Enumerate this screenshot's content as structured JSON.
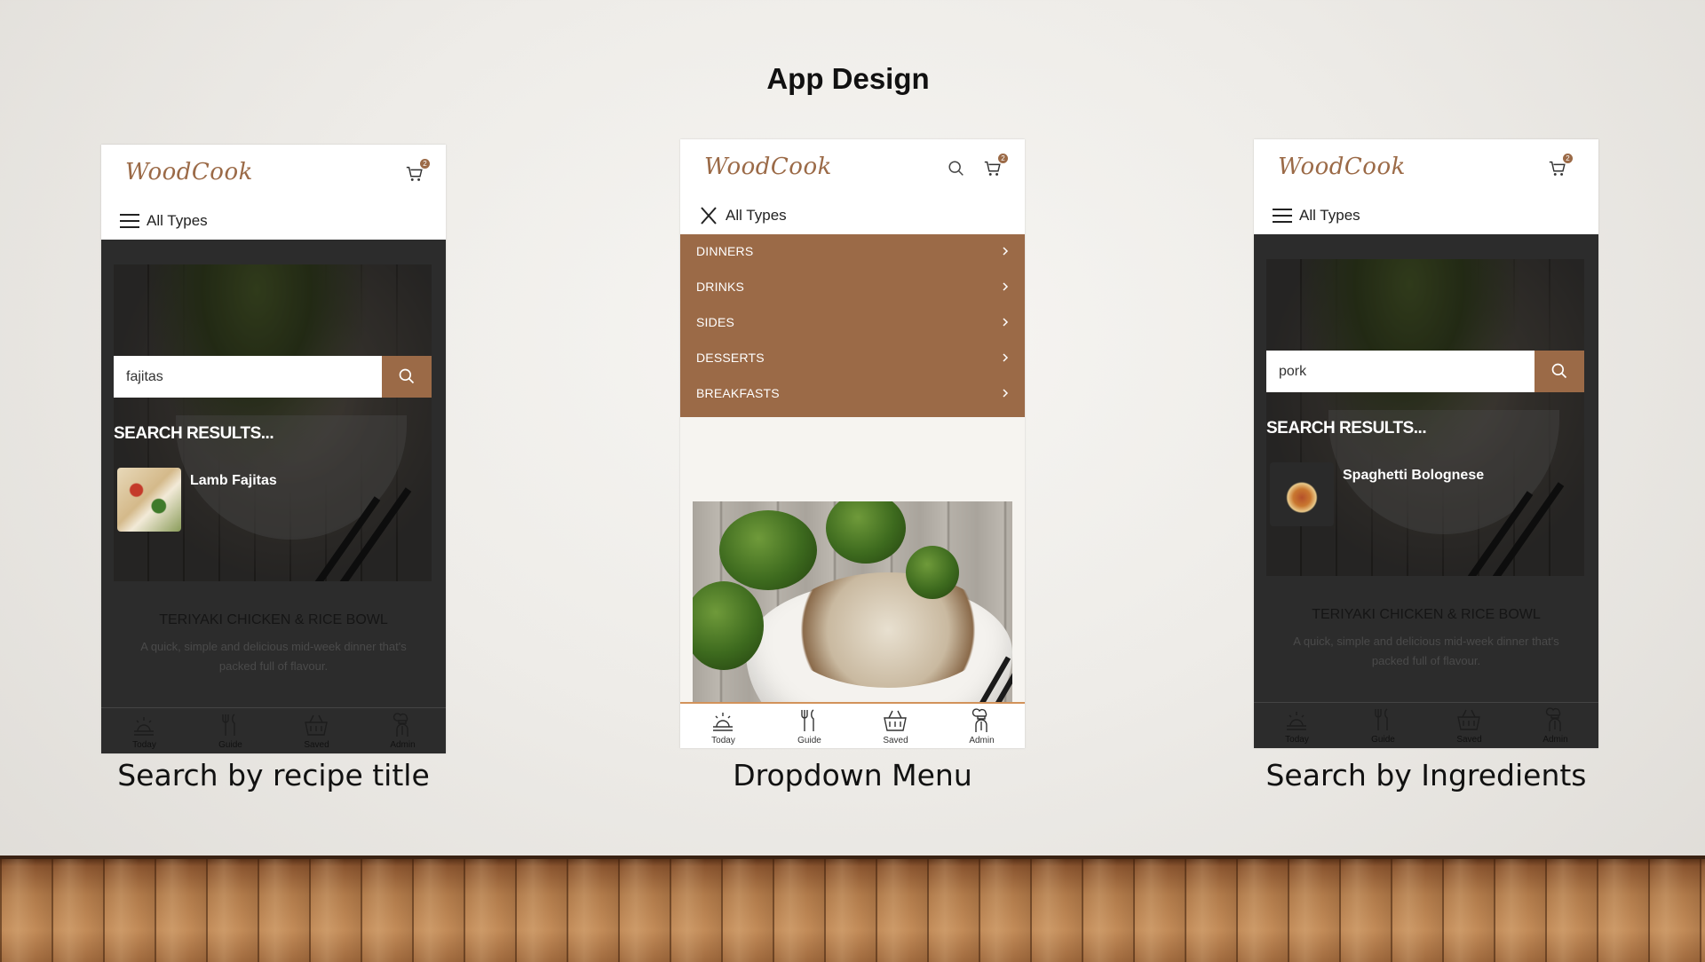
{
  "slide": {
    "title": "App Design"
  },
  "captions": [
    "Search by recipe title",
    "Dropdown Menu",
    "Search by Ingredients"
  ],
  "app": {
    "logo": "WoodCook",
    "cart_count": "2",
    "type_filter": "All Types",
    "search_results_heading": "SEARCH RESULTS...",
    "feature": {
      "title": "TERIYAKI CHICKEN & RICE BOWL",
      "description": "A quick, simple and delicious mid-week dinner that's packed full of flavour."
    },
    "nav": [
      "Today",
      "Guide",
      "Saved",
      "Admin"
    ],
    "accent_color": "#9b6a47"
  },
  "screen1": {
    "search_value": "fajitas",
    "result": "Lamb Fajitas"
  },
  "screen2": {
    "menu": [
      "DINNERS",
      "DRINKS",
      "SIDES",
      "DESSERTS",
      "BREAKFASTS"
    ]
  },
  "screen3": {
    "search_value": "pork",
    "result": "Spaghetti Bolognese"
  }
}
